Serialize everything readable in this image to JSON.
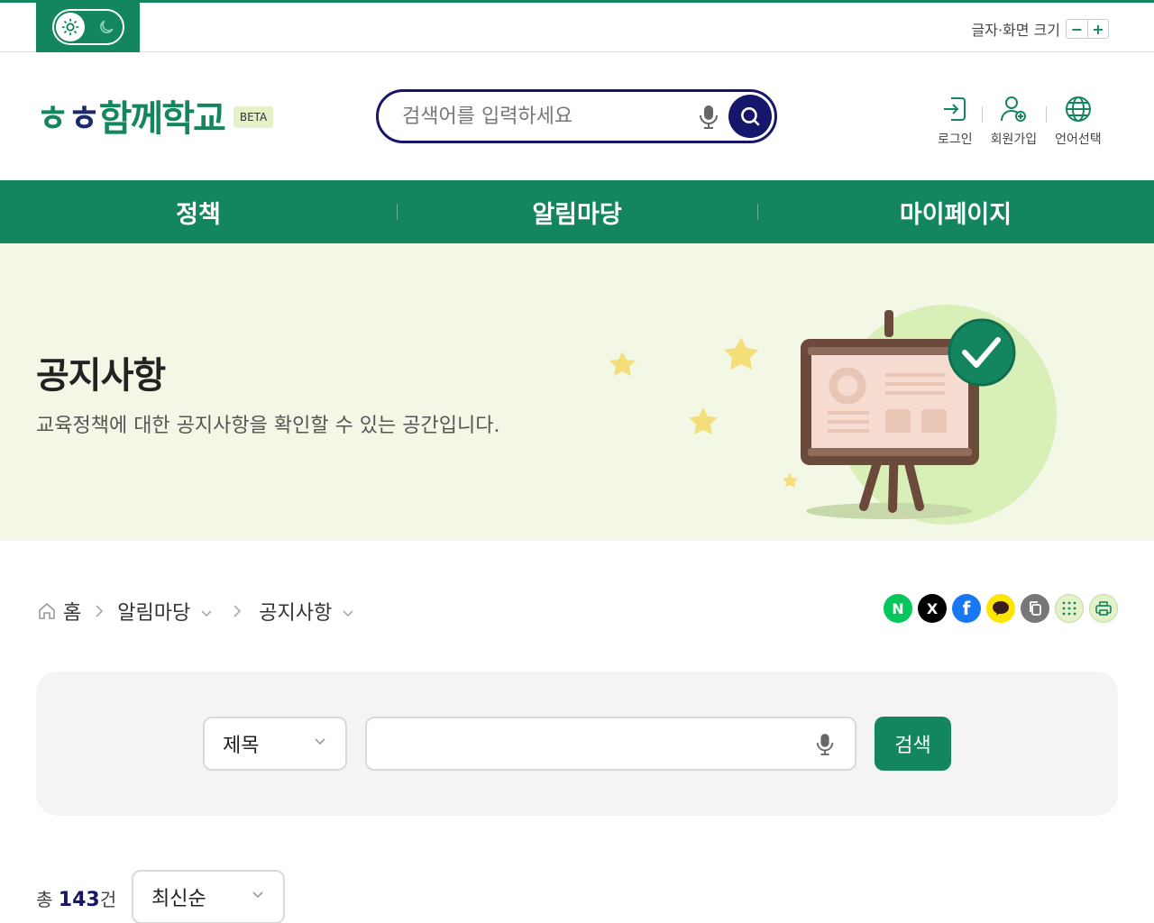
{
  "utility": {
    "font_size_label": "글자·화면 크기",
    "minus": "−",
    "plus": "+"
  },
  "header": {
    "logo_a": "ㅎ",
    "logo_b": "ㅎ",
    "logo_c": "함께",
    "logo_d": "학교",
    "beta": "BETA",
    "search_placeholder": "검색어를 입력하세요",
    "links": [
      {
        "label": "로그인",
        "icon": "login-icon"
      },
      {
        "label": "회원가입",
        "icon": "user-add-icon"
      },
      {
        "label": "언어선택",
        "icon": "globe-icon"
      }
    ]
  },
  "gnb": {
    "items": [
      "정책",
      "알림마당",
      "마이페이지"
    ]
  },
  "banner": {
    "title": "공지사항",
    "description": "교육정책에 대한 공지사항을 확인할 수 있는 공간입니다."
  },
  "breadcrumb": {
    "home": "홈",
    "level1": "알림마당",
    "level2": "공지사항"
  },
  "share": [
    {
      "label": "N",
      "icon": "naver-icon",
      "color": "#03c75a"
    },
    {
      "label": "X",
      "icon": "x-twitter-icon",
      "color": "#000000"
    },
    {
      "label": "f",
      "icon": "facebook-icon",
      "color": "#1877f2"
    },
    {
      "label": "",
      "icon": "kakaotalk-icon",
      "color": "#fee500"
    },
    {
      "label": "",
      "icon": "copy-link-icon",
      "color": "#777777"
    },
    {
      "label": "",
      "icon": "qr-icon",
      "color": "#e4f1c9"
    },
    {
      "label": "",
      "icon": "print-icon",
      "color": "#e4f1c9"
    }
  ],
  "search_panel": {
    "field_select": "제목",
    "keyword_value": "",
    "submit": "검색"
  },
  "list": {
    "total_prefix": "총 ",
    "total_count": "143",
    "total_suffix": "건",
    "sort_select": "최신순"
  },
  "colors": {
    "brand_green": "#13865f",
    "navy": "#16166b",
    "banner_bg": "#f3f7e6"
  }
}
